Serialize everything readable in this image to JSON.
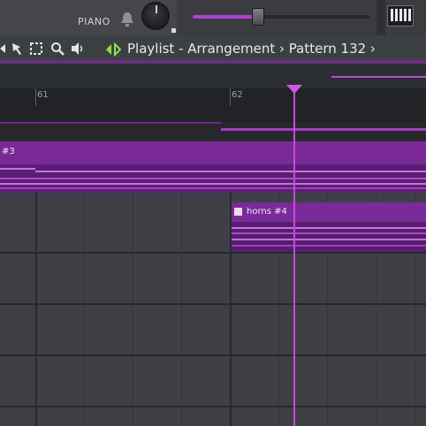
{
  "mixer": {
    "channel_label": "PIANO",
    "volume_fraction": 0.37
  },
  "toolbar": {
    "breadcrumb": [
      "Playlist",
      "Arrangement",
      "Pattern 132"
    ],
    "title": "Playlist - Arrangement › Pattern 132 ›"
  },
  "timeline": {
    "bars": [
      "61",
      "62"
    ]
  },
  "clips": {
    "clip_1_label": "#3",
    "clip_2_label": "horns #4"
  },
  "colors": {
    "accent": "#c54be0",
    "clip": "#7a2997",
    "background": "#2b2d30"
  },
  "icons": [
    "bell-icon",
    "keyboard-icon",
    "pencil-tool-icon",
    "select-tool-icon",
    "zoom-tool-icon",
    "speaker-icon",
    "play-arrow-icon"
  ]
}
